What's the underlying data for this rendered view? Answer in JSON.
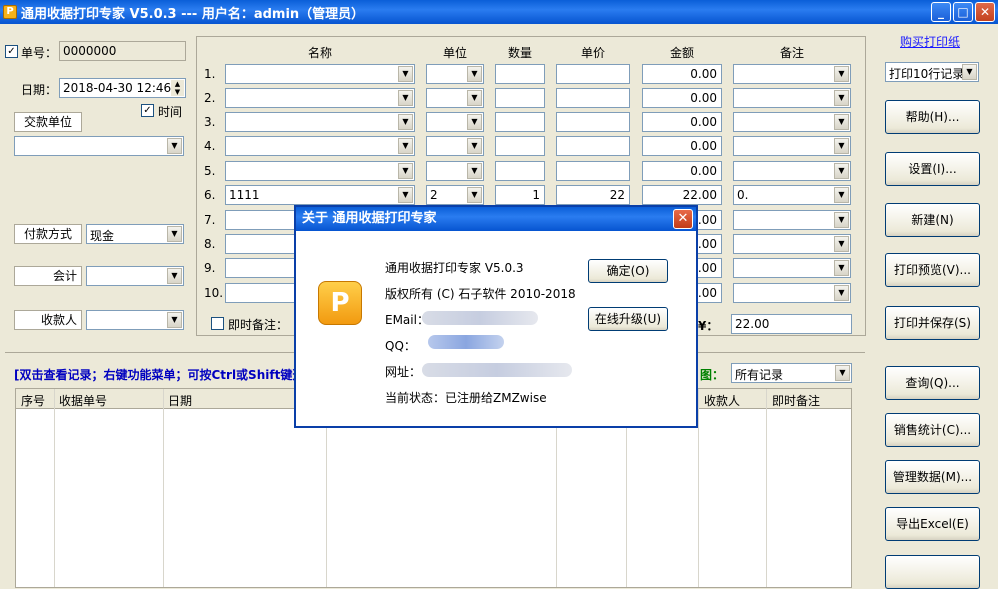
{
  "window": {
    "title": "通用收据打印专家 V5.0.3 --- 用户名：admin（管理员）",
    "min": "_",
    "max": "□",
    "close": "✕"
  },
  "left": {
    "receipt_no_label": "单号：",
    "receipt_no": "0000000",
    "date_label": "日期：",
    "date_value": "2018-04-30 12:46:",
    "time_check": "时间",
    "payer_button": "交款单位",
    "pay_method_button": "付款方式",
    "pay_method_value": "现金",
    "accountant_button": "会计",
    "cashier_button": "收款人"
  },
  "table": {
    "headers": [
      "名称",
      "单位",
      "数量",
      "单价",
      "金额",
      "备注"
    ],
    "rows": [
      {
        "no": "1.",
        "name": "",
        "unit": "",
        "qty": "",
        "price": "",
        "amount": "0.00",
        "note": ""
      },
      {
        "no": "2.",
        "name": "",
        "unit": "",
        "qty": "",
        "price": "",
        "amount": "0.00",
        "note": ""
      },
      {
        "no": "3.",
        "name": "",
        "unit": "",
        "qty": "",
        "price": "",
        "amount": "0.00",
        "note": ""
      },
      {
        "no": "4.",
        "name": "",
        "unit": "",
        "qty": "",
        "price": "",
        "amount": "0.00",
        "note": ""
      },
      {
        "no": "5.",
        "name": "",
        "unit": "",
        "qty": "",
        "price": "",
        "amount": "0.00",
        "note": ""
      },
      {
        "no": "6.",
        "name": "1111",
        "unit": "2",
        "qty": "1",
        "price": "22",
        "amount": "22.00",
        "note": "0."
      },
      {
        "no": "7.",
        "name": "",
        "unit": "",
        "qty": "",
        "price": "",
        "amount": "0.00",
        "note": ""
      },
      {
        "no": "8.",
        "name": "",
        "unit": "",
        "qty": "",
        "price": "",
        "amount": "0.00",
        "note": ""
      },
      {
        "no": "9.",
        "name": "",
        "unit": "",
        "qty": "",
        "price": "",
        "amount": "0.00",
        "note": ""
      },
      {
        "no": "10.",
        "name": "",
        "unit": "",
        "qty": "",
        "price": "",
        "amount": "0.00",
        "note": ""
      }
    ],
    "instant_note_label": "即时备注：",
    "total_symbol": "¥：",
    "total_value": "22.00"
  },
  "right": {
    "buy_link": "购买打印纸",
    "print_mode": "打印10行记录",
    "help": "帮助(H)...",
    "settings": "设置(I)...",
    "new": "新建(N)",
    "preview": "打印预览(V)...",
    "print_save": "打印并保存(S)",
    "query": "查询(Q)...",
    "sales": "销售统计(C)...",
    "manage": "管理数据(M)...",
    "export": "导出Excel(E)"
  },
  "records": {
    "hint": "[双击查看记录；右键功能菜单；可按Ctrl或Shift键选去",
    "filter_label": "图：",
    "filter_value": "所有记录",
    "columns": [
      "序号",
      "收据单号",
      "日期",
      "收款人",
      "即时备注"
    ]
  },
  "about": {
    "title": "关于 通用收据打印专家",
    "logo_letter": "P",
    "product": "通用收据打印专家 V5.0.3",
    "copyright": "版权所有 (C) 石子软件 2010-2018",
    "email_label": "EMail：",
    "qq_label": "QQ：",
    "web_label": "网址：",
    "status": "当前状态：已注册给ZMZwise",
    "ok": "确定(O)",
    "upgrade": "在线升级(U)"
  },
  "colors": {
    "titlebar": "#0a5fd8",
    "link": "#1a1aff",
    "hint": "#0000c0"
  }
}
